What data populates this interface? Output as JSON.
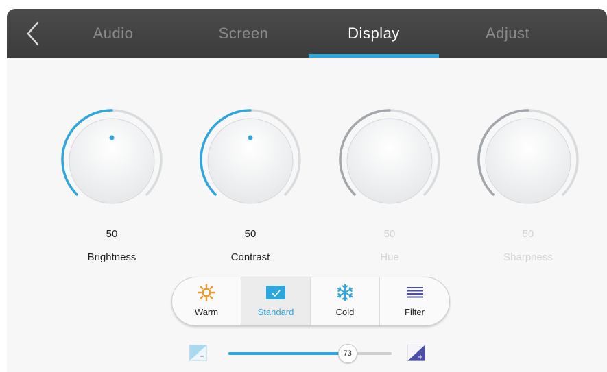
{
  "tabs": [
    {
      "label": "Audio",
      "active": false
    },
    {
      "label": "Screen",
      "active": false
    },
    {
      "label": "Display",
      "active": true
    },
    {
      "label": "Adjust",
      "active": false
    }
  ],
  "knobs": [
    {
      "label": "Brightness",
      "value": "50",
      "enabled": true
    },
    {
      "label": "Contrast",
      "value": "50",
      "enabled": true
    },
    {
      "label": "Hue",
      "value": "50",
      "enabled": false
    },
    {
      "label": "Sharpness",
      "value": "50",
      "enabled": false
    }
  ],
  "color_modes": [
    {
      "label": "Warm",
      "icon": "sun-icon",
      "selected": false
    },
    {
      "label": "Standard",
      "icon": "standard-check-icon",
      "selected": true
    },
    {
      "label": "Cold",
      "icon": "snowflake-icon",
      "selected": false
    },
    {
      "label": "Filter",
      "icon": "filter-lines-icon",
      "selected": false
    }
  ],
  "slider": {
    "value": "73",
    "fraction": 0.73,
    "min_icon": "decrease-icon",
    "max_icon": "increase-icon"
  },
  "colors": {
    "accent": "#2ea7dd",
    "topbar": "#404040",
    "warm": "#f39a1e",
    "filter": "#4b4fa8"
  }
}
